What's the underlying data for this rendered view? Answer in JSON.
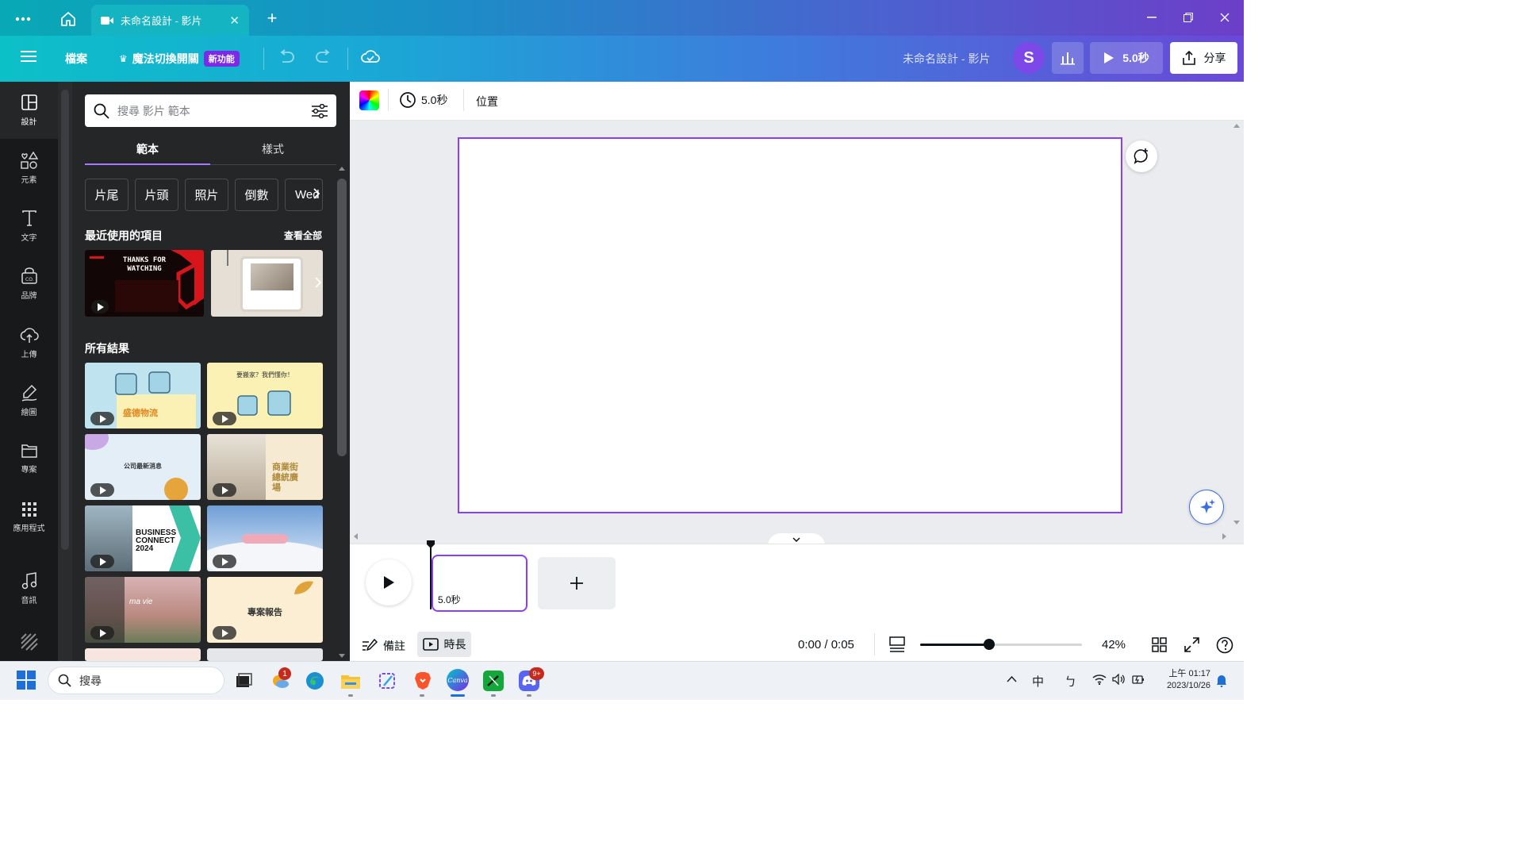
{
  "browser": {
    "tab_title": "未命名設計 - 影片"
  },
  "header": {
    "file_label": "檔案",
    "magic_switch_label": "魔法切換開關",
    "new_badge": "新功能",
    "design_title": "未命名設計 - 影片",
    "avatar_initial": "S",
    "play_duration": "5.0秒",
    "share_label": "分享"
  },
  "rail": {
    "items": [
      {
        "label": "設計",
        "icon": "layout-icon"
      },
      {
        "label": "元素",
        "icon": "shapes-icon"
      },
      {
        "label": "文字",
        "icon": "text-icon"
      },
      {
        "label": "品牌",
        "icon": "brand-icon"
      },
      {
        "label": "上傳",
        "icon": "upload-icon"
      },
      {
        "label": "繪圖",
        "icon": "draw-icon"
      },
      {
        "label": "專案",
        "icon": "folder-icon"
      },
      {
        "label": "應用程式",
        "icon": "apps-icon"
      },
      {
        "label": "音訊",
        "icon": "music-icon"
      }
    ]
  },
  "panel": {
    "search_placeholder": "搜尋 影片 範本",
    "tabs": [
      "範本",
      "樣式"
    ],
    "chips": [
      "片尾",
      "片頭",
      "照片",
      "倒數",
      "Wed"
    ],
    "recent_title": "最近使用的項目",
    "see_all": "查看全部",
    "recent_thumb1_text": "THANKS FOR WATCHING",
    "all_results_title": "所有結果",
    "results": [
      {
        "text": "盛德物流"
      },
      {
        "text": "要搬家？我們懂你！"
      },
      {
        "text": "公司最新消息"
      },
      {
        "text": "商業街總統廣場"
      },
      {
        "text": "BUSINESS CONNECT 2024"
      },
      {
        "text": ""
      },
      {
        "text": "ma vie"
      },
      {
        "text": "專案報告"
      }
    ]
  },
  "toolbar": {
    "duration": "5.0秒",
    "position": "位置"
  },
  "timeline": {
    "clip_duration": "5.0秒",
    "notes_label": "備註",
    "duration_label": "時長",
    "time_readout": "0:00 / 0:05",
    "zoom": "42%",
    "zoom_level": 0.42
  },
  "taskbar": {
    "search_placeholder": "搜尋",
    "ime_label": "中",
    "ime_mode": "ㄅ",
    "clock_time": "上午 01:17",
    "clock_date": "2023/10/26",
    "badge_count_1": "1",
    "badge_count_2": "9+"
  },
  "colors": {
    "accent": "#8b3dff",
    "panel_bg": "#252627",
    "rail_bg": "#18191b"
  }
}
